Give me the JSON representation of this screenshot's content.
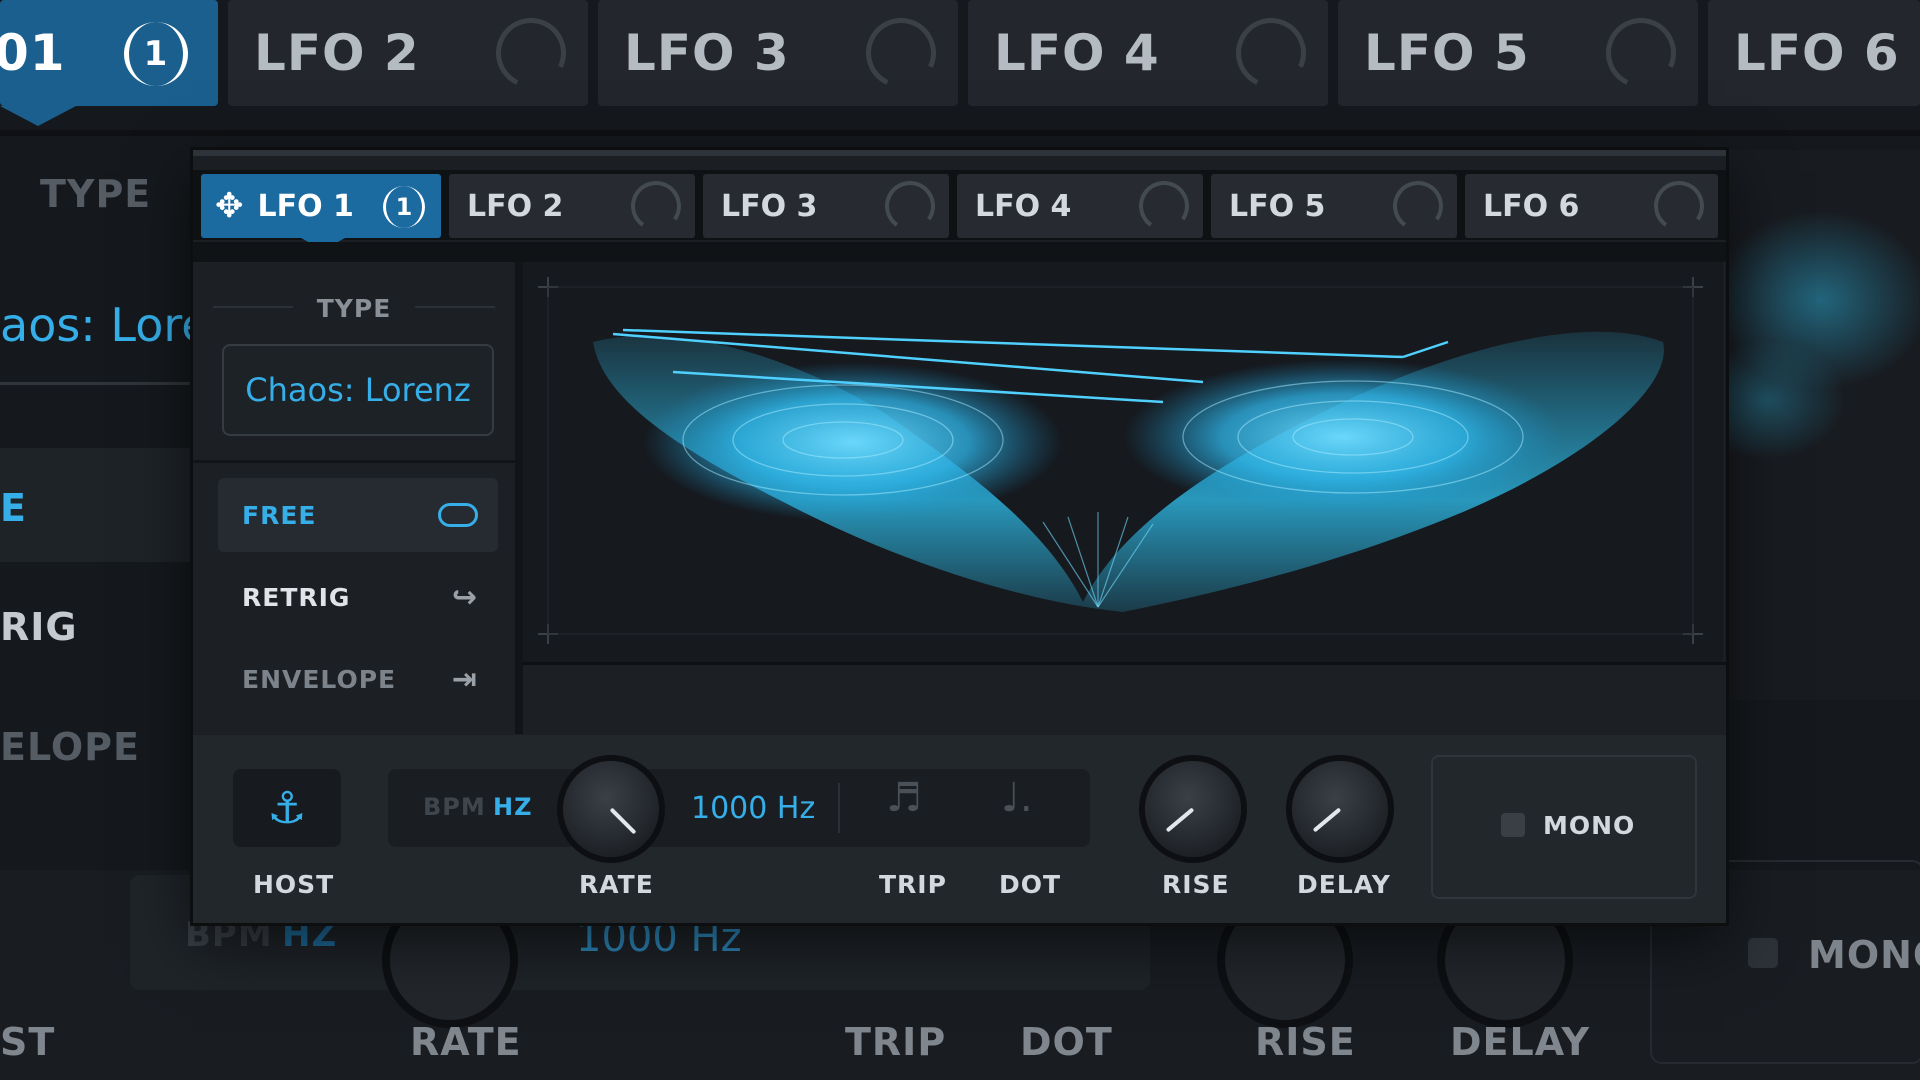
{
  "background_tabs": [
    {
      "label": "01",
      "badge": "1",
      "active": true
    },
    {
      "label": "LFO 2"
    },
    {
      "label": "LFO 3"
    },
    {
      "label": "LFO 4"
    },
    {
      "label": "LFO 5"
    },
    {
      "label": "LFO 6"
    }
  ],
  "background": {
    "type_label": "TYPE",
    "type_value": "aos: Lore",
    "modes": [
      "E",
      "RIG",
      "ELOPE"
    ],
    "bottom": {
      "bpm": "BPM",
      "hz": "HZ",
      "rate_value": "1000 Hz",
      "labels": [
        "ST",
        "RATE",
        "TRIP",
        "DOT",
        "RISE",
        "DELAY"
      ],
      "mono": "MONO"
    }
  },
  "tabs": [
    {
      "label": "LFO 1",
      "badge": "1",
      "active": true
    },
    {
      "label": "LFO 2"
    },
    {
      "label": "LFO 3"
    },
    {
      "label": "LFO 4"
    },
    {
      "label": "LFO 5"
    },
    {
      "label": "LFO 6"
    }
  ],
  "sidebar": {
    "type_label": "TYPE",
    "type_value": "Chaos: Lorenz",
    "modes": [
      {
        "label": "FREE",
        "icon": "loop-icon",
        "selected": true
      },
      {
        "label": "RETRIG",
        "icon": "retrig-icon"
      },
      {
        "label": "ENVELOPE",
        "icon": "envelope-icon"
      }
    ]
  },
  "controls": {
    "host_label": "HOST",
    "bpm": "BPM",
    "hz": "HZ",
    "rate_label": "RATE",
    "rate_value": "1000 Hz",
    "trip_label": "TRIP",
    "dot_label": "DOT",
    "rise_label": "RISE",
    "delay_label": "DELAY",
    "mono_label": "MONO"
  },
  "colors": {
    "accent": "#1b6aa0",
    "value_text": "#36aee8",
    "attractor": "#2fc2f0"
  }
}
